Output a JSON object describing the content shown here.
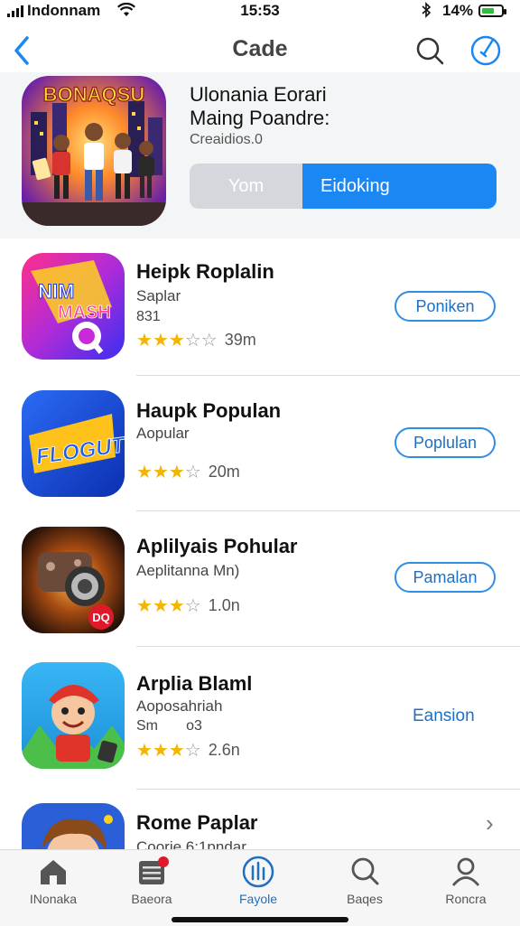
{
  "status_bar": {
    "carrier": "Indonnam",
    "time": "15:53",
    "battery_percent": "14%",
    "battery_level": 0.65
  },
  "nav": {
    "title": "Cade"
  },
  "featured": {
    "art_text": "BONAQSU",
    "name_line1": "Ulonania Eorari",
    "name_line2": "Maing Poandre:",
    "developer": "Creaidios.0",
    "segment_left": "Yom",
    "segment_right": "Eidoking"
  },
  "apps": [
    {
      "icon_text_1": "NIM",
      "icon_text_2": "MASH",
      "name": "Heipk Roplalin",
      "subtitle": "Saplar",
      "meta": "831",
      "stars": 3,
      "size": "39m",
      "action": "Poniken"
    },
    {
      "icon_text_1": "FLOGUT",
      "name": "Haupk Populan",
      "subtitle": "Aopular",
      "stars": 3,
      "size": "20m",
      "action": "Poplulan"
    },
    {
      "icon_text_1": "DQ",
      "name": "Aplilyais Pohular",
      "subtitle": "Aeplitanna Mn)",
      "stars": 3,
      "size": "1.0n",
      "action": "Pamalan"
    },
    {
      "name": "Arplia Blaml",
      "subtitle": "Aoposahriah",
      "meta": "Sm       o3",
      "stars": 3,
      "size": "2.6n",
      "action": "Eansion"
    },
    {
      "name": "Rome Paplar",
      "subtitle": "Coorie 6:1pndar"
    }
  ],
  "tabs": [
    {
      "label": "INonaka"
    },
    {
      "label": "Baeora"
    },
    {
      "label": "Fayole"
    },
    {
      "label": "Baqes"
    },
    {
      "label": "Roncra"
    }
  ]
}
